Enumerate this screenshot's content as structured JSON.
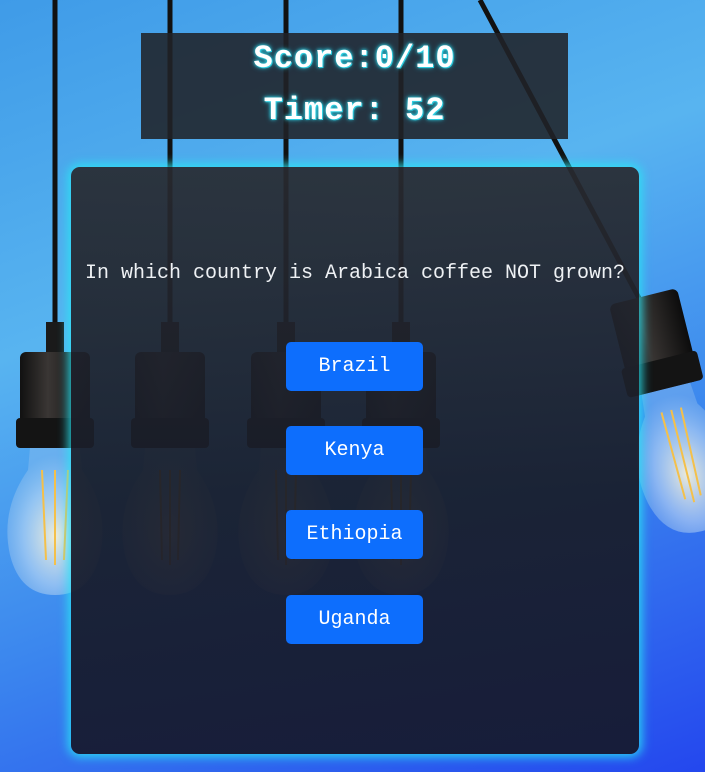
{
  "scoreboard": {
    "score_text": "Score:0/10",
    "timer_text": "Timer: 52"
  },
  "quiz": {
    "question": "In which country is Arabica coffee NOT grown?",
    "answers": [
      {
        "label": "Brazil"
      },
      {
        "label": "Kenya"
      },
      {
        "label": "Ethiopia"
      },
      {
        "label": "Uganda"
      }
    ]
  },
  "colors": {
    "answer_button": "#0d6efd",
    "card_glow": "#28e6f5",
    "panel_bg": "#202228"
  }
}
